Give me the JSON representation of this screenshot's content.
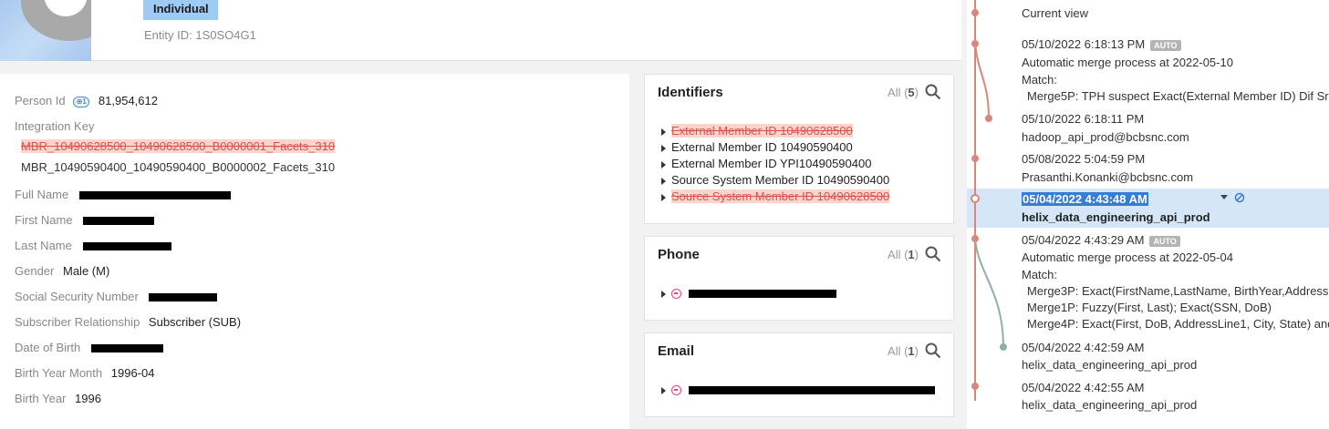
{
  "header": {
    "entity_type": "Individual",
    "entity_id": "Entity ID: 1S0SO4G1"
  },
  "attributes": {
    "person_id_label": "Person Id",
    "person_id_value": "81,954,612",
    "integration_key_label": "Integration Key",
    "integration_keys": [
      "MBR_10490628500_10490628500_B0000001_Facets_310",
      "MBR_10490590400_10490590400_B0000002_Facets_310"
    ],
    "full_name_label": "Full Name",
    "first_name_label": "First Name",
    "last_name_label": "Last Name",
    "gender_label": "Gender",
    "gender_value": "Male (M)",
    "ssn_label": "Social Security Number",
    "subscriber_rel_label": "Subscriber Relationship",
    "subscriber_rel_value": "Subscriber (SUB)",
    "dob_label": "Date of Birth",
    "birth_year_month_label": "Birth Year Month",
    "birth_year_month_value": "1996-04",
    "birth_year_label": "Birth Year",
    "birth_year_value": "1996"
  },
  "identifiers": {
    "title": "Identifiers",
    "count_prefix": "All (",
    "count": "5",
    "count_suffix": ")",
    "items": [
      "External Member ID 10490628500",
      "External Member ID 10490590400",
      "External Member ID YPI10490590400",
      "Source System Member ID 10490590400",
      "Source System Member ID 10490628500"
    ]
  },
  "phone": {
    "title": "Phone",
    "count_prefix": "All (",
    "count": "1",
    "count_suffix": ")"
  },
  "email": {
    "title": "Email",
    "count_prefix": "All (",
    "count": "1",
    "count_suffix": ")"
  },
  "history": {
    "current_view": "Current view",
    "entries": [
      {
        "time": "05/10/2022 6:18:13 PM",
        "badge": "AUTO",
        "line1": "Automatic merge process at 2022-05-10",
        "line2": "Match:",
        "line3": "Merge5P: TPH suspect Exact(External Member ID) Dif Sr"
      },
      {
        "time": "05/10/2022 6:18:11 PM",
        "user": "hadoop_api_prod@bcbsnc.com"
      },
      {
        "time": "05/08/2022 5:04:59 PM",
        "user": "Prasanthi.Konanki@bcbsnc.com"
      },
      {
        "time": "05/04/2022 4:43:48 AM",
        "user": "helix_data_engineering_api_prod"
      },
      {
        "time": "05/04/2022 4:43:29 AM",
        "badge": "AUTO",
        "line1": "Automatic merge process at 2022-05-04",
        "line2": "Match:",
        "line3": "Merge3P: Exact(FirstName,LastName, BirthYear,Address",
        "line4": "Merge1P: Fuzzy(First, Last); Exact(SSN, DoB)",
        "line5": "Merge4P: Exact(First, DoB, AddressLine1, City, State) and"
      },
      {
        "time": "05/04/2022 4:42:59 AM",
        "user": "helix_data_engineering_api_prod"
      },
      {
        "time": "05/04/2022 4:42:55 AM",
        "user": "helix_data_engineering_api_prod"
      }
    ]
  },
  "colors": {
    "timeline_main": "#d9877a",
    "timeline_branch": "#8fb0a8",
    "selected_bg": "#d4e6f7",
    "badge_blue": "#9ecbf4"
  }
}
